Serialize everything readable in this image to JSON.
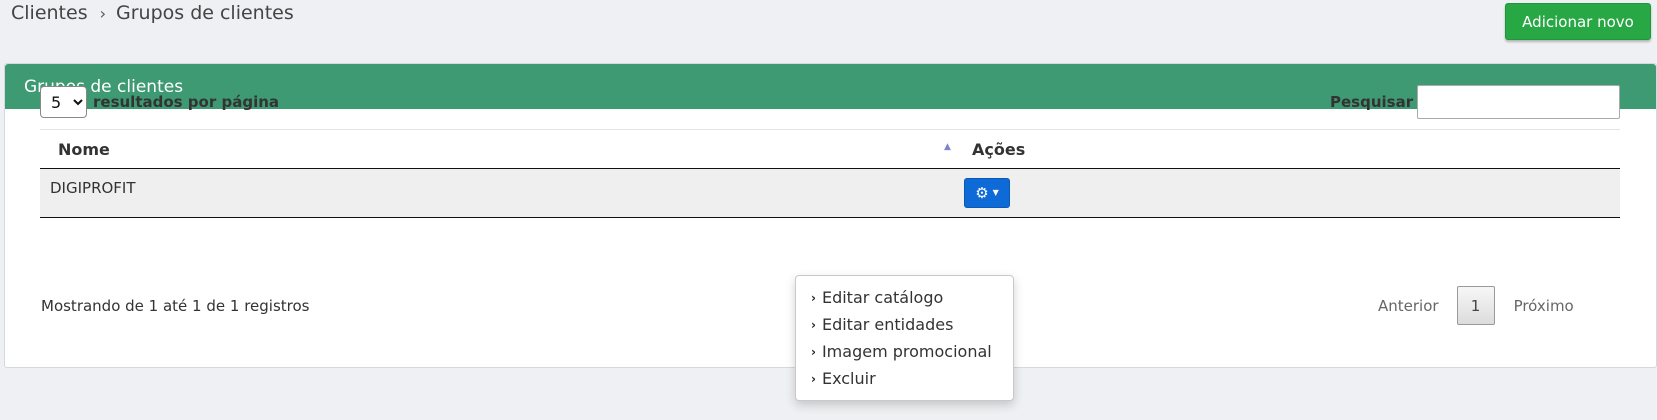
{
  "breadcrumb": {
    "items": [
      "Clientes",
      "Grupos de clientes"
    ],
    "separator": "›"
  },
  "header": {
    "add_button_label": "Adicionar novo"
  },
  "panel": {
    "title": "Grupos de clientes"
  },
  "controls": {
    "per_page_value": "5",
    "per_page_options": [
      "5"
    ],
    "per_page_label": "resultados por página",
    "search_label": "Pesquisar",
    "search_value": ""
  },
  "table": {
    "columns": [
      "Nome",
      "Ações"
    ],
    "sort_indicator": "▲",
    "rows": [
      {
        "nome": "DIGIPROFIT"
      }
    ]
  },
  "actions_button": {
    "icon": "gear-icon",
    "caret": "▼"
  },
  "dropdown": {
    "items": [
      {
        "label": "Editar catálogo"
      },
      {
        "label": "Editar entidades"
      },
      {
        "label": "Imagem promocional"
      },
      {
        "label": "Excluir"
      }
    ],
    "bullet": "›"
  },
  "footer": {
    "info": "Mostrando de 1 até 1 de 1 registros",
    "prev": "Anterior",
    "current_page": "1",
    "next": "Próximo"
  },
  "colors": {
    "panel_header": "#3e9a73",
    "add_button": "#28a745",
    "action_button": "#0d6ad6",
    "page_background": "#eef0f3"
  }
}
